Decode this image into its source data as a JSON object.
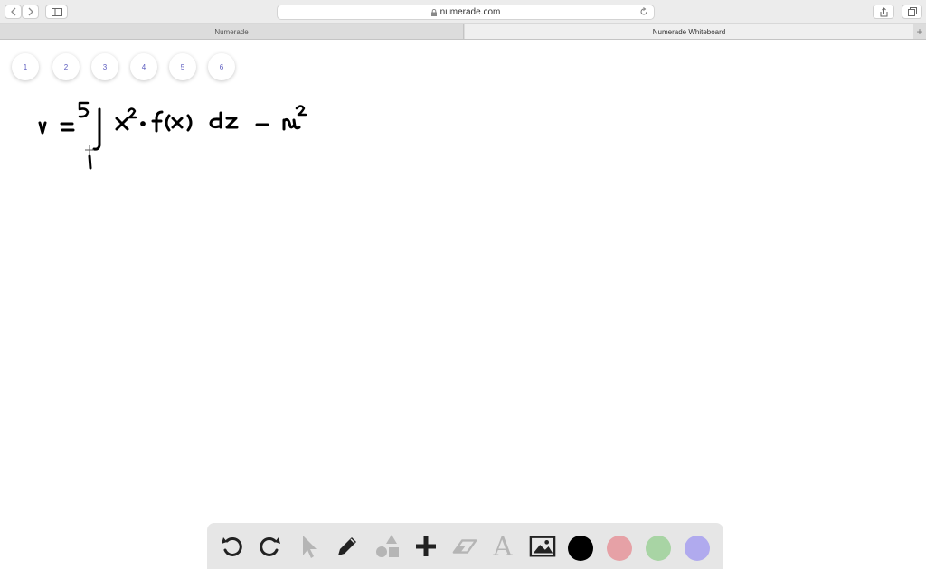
{
  "browser": {
    "url": "numerade.com",
    "tabs": [
      {
        "label": "Numerade"
      },
      {
        "label": "Numerade Whiteboard"
      }
    ],
    "new_tab_label": "+"
  },
  "pages": [
    "1",
    "2",
    "3",
    "4",
    "5",
    "6"
  ],
  "tools": {
    "icons": [
      "undo-icon",
      "redo-icon",
      "pointer-icon",
      "pencil-icon",
      "shapes-icon",
      "plus-icon",
      "eraser-icon",
      "text-icon",
      "image-icon"
    ],
    "text_tool_glyph": "A",
    "colors": [
      "#000000",
      "#e6a1a6",
      "#a8d4a4",
      "#b0aaee"
    ]
  }
}
